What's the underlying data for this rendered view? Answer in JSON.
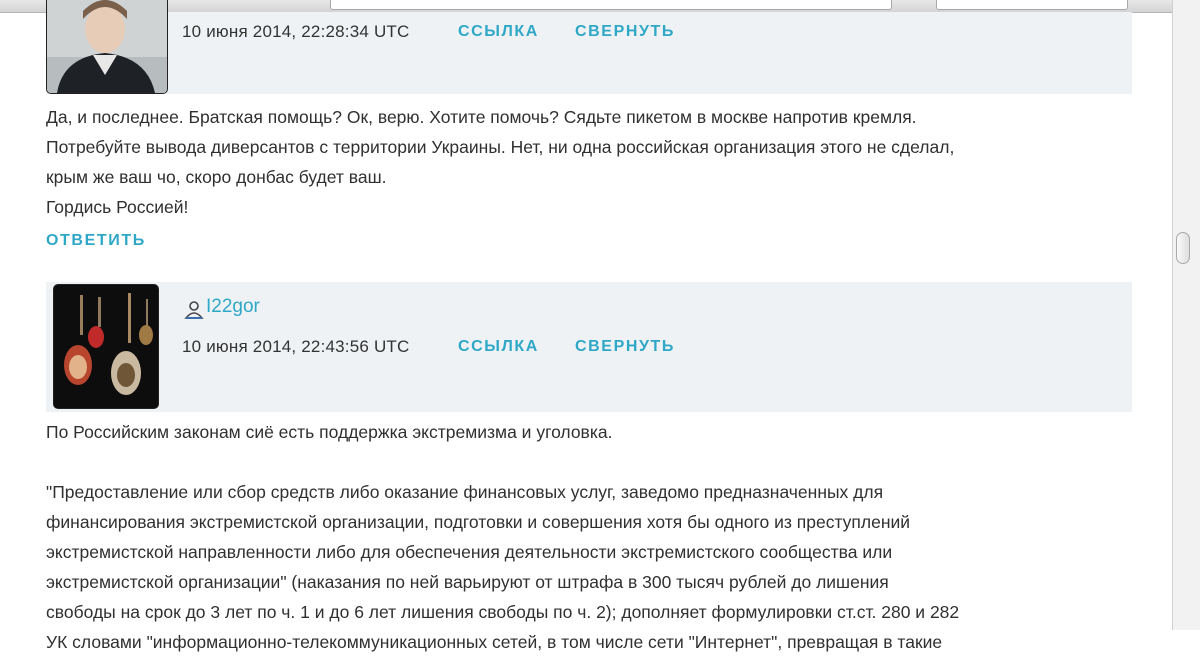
{
  "comment_1": {
    "timestamp": "10 июня 2014, 22:28:34 UTC",
    "link_label": "ССЫЛКА",
    "collapse_label": "СВЕРНУТЬ",
    "lines": [
      "Да, и последнее. Братская помощь? Ок, верю. Хотите помочь? Сядьте пикетом в москве напротив кремля.",
      "Потребуйте вывода диверсантов с территории Украины. Нет, ни одна российская организация этого не сделал,",
      "крым же ваш чо, скоро донбас будет ваш.",
      "Гордись Россией!"
    ],
    "reply_label": "ОТВЕТИТЬ"
  },
  "comment_2": {
    "username": "I22gor",
    "timestamp": "10 июня 2014, 22:43:56 UTC",
    "link_label": "ССЫЛКА",
    "collapse_label": "СВЕРНУТЬ",
    "paragraph_1": "По Российским законам сиё есть поддержка экстремизма и уголовка.",
    "paragraph_2_lines": [
      "\"Предоставление или сбор средств либо оказание финансовых услуг, заведомо предназначенных для",
      "финансирования экстремистской организации, подготовки и совершения хотя бы одного из преступлений",
      "экстремистской направленности либо для обеспечения деятельности экстремистского сообщества или",
      "экстремистской организации\" (наказания по ней варьируют от штрафа в 300 тысяч рублей до лишения",
      "свободы на срок до 3 лет по ч. 1 и до 6 лет лишения свободы по ч. 2); дополняет формулировки ст.ст. 280 и 282",
      "УК словами \"информационно-телекоммуникационных сетей, в том числе сети \"Интернет\", превращая в такие"
    ]
  },
  "colors": {
    "accent": "#2fa8c8",
    "header_band": "#eef2f4",
    "text": "#303030"
  },
  "icons": {
    "user": "user-icon",
    "scrollbar": "scrollbar-thumb"
  }
}
